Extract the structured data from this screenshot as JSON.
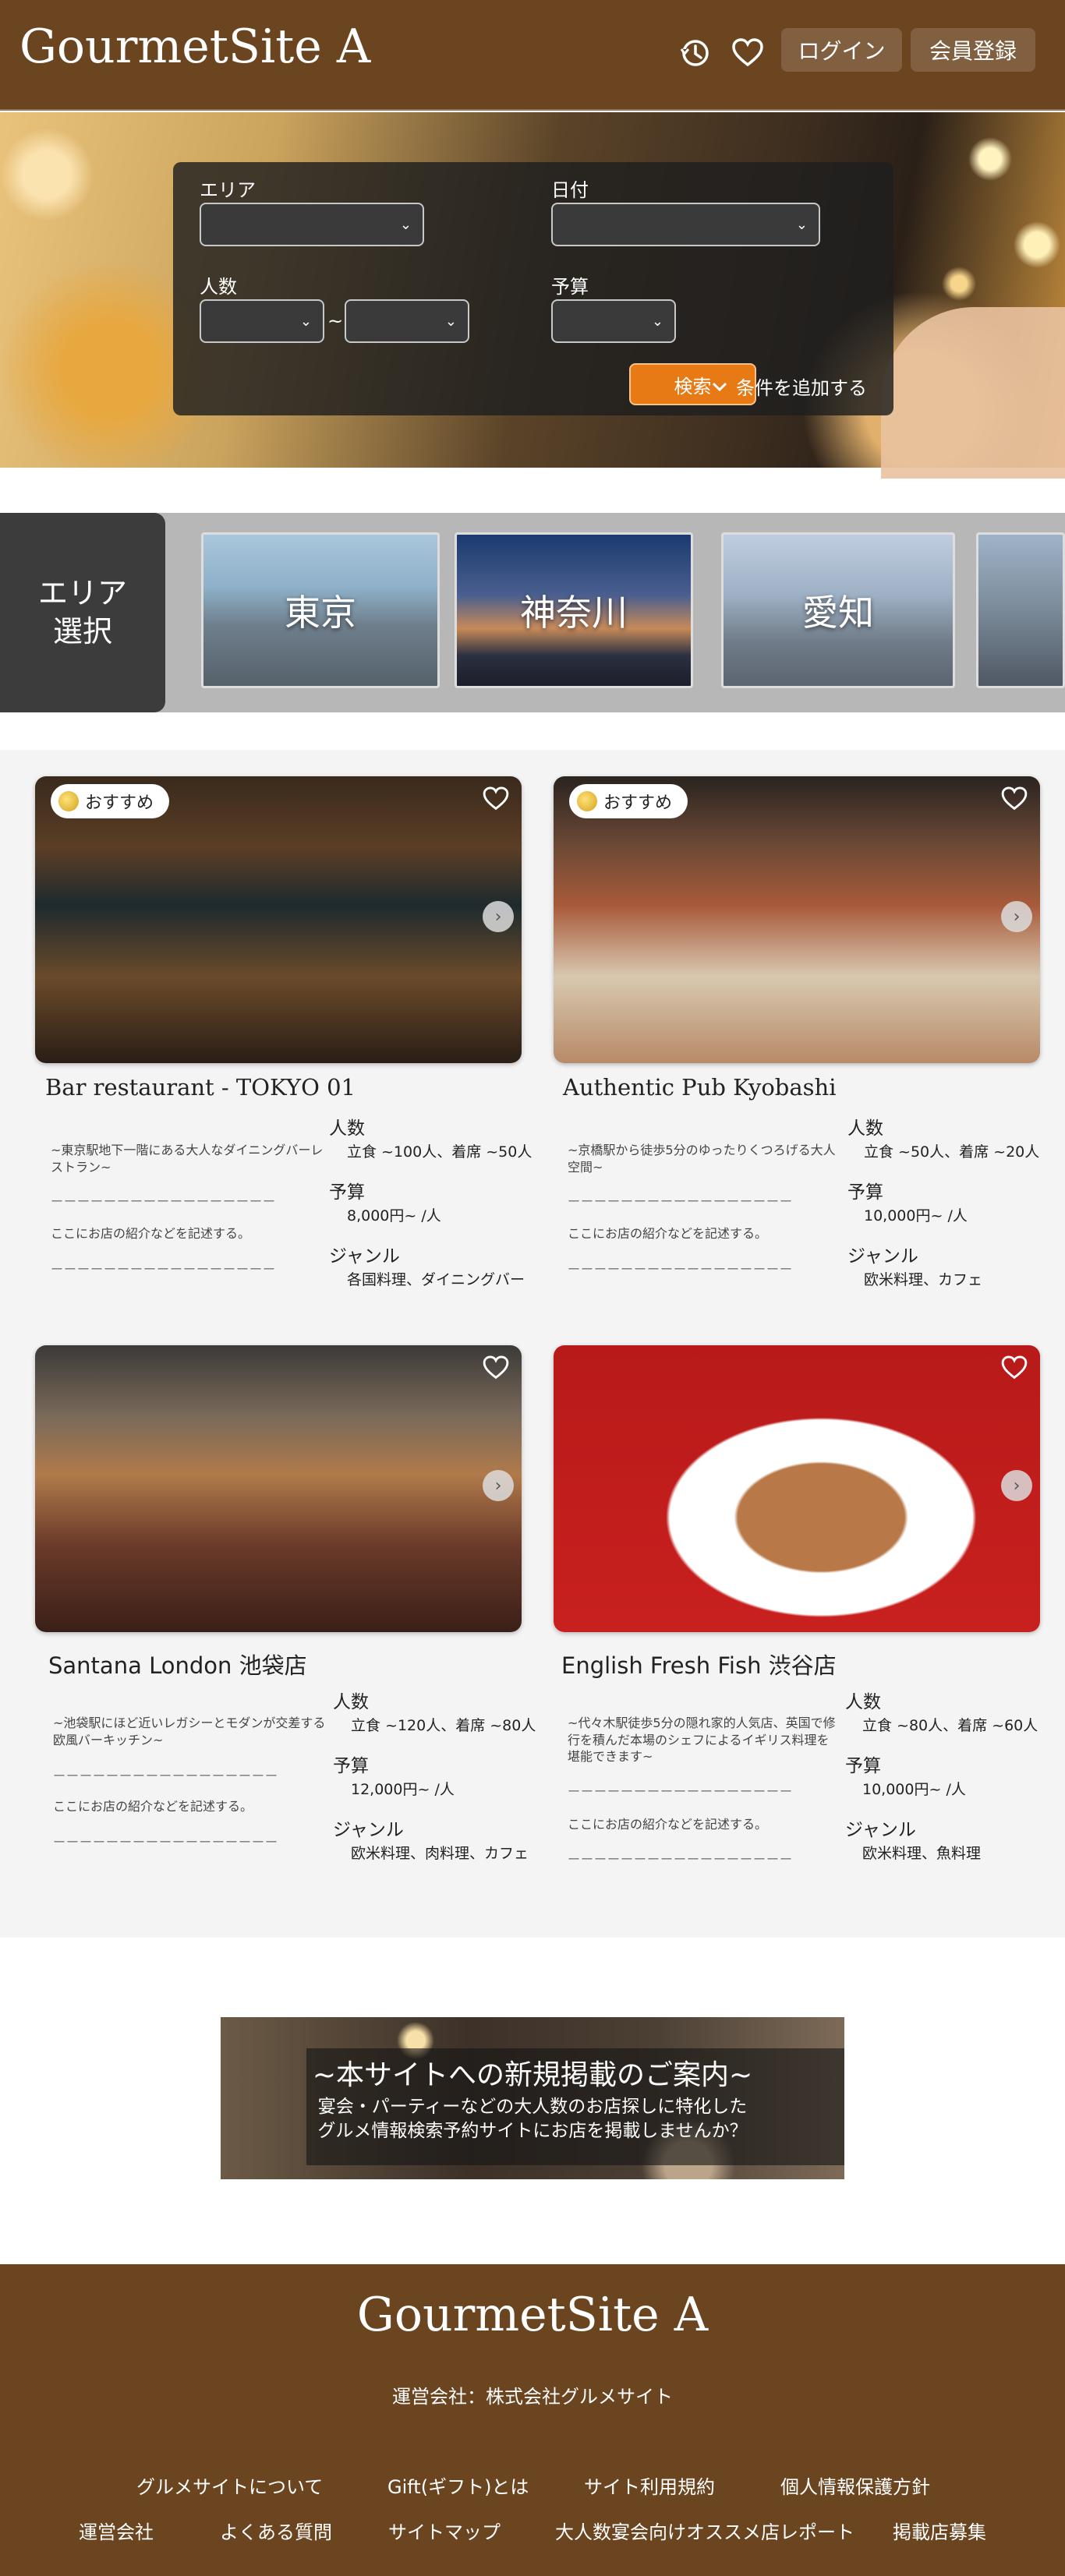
{
  "header": {
    "logo": "GourmetSite A",
    "history_icon": "history-icon",
    "favorite_icon": "heart-icon",
    "login_label": "ログイン",
    "register_label": "会員登録"
  },
  "search": {
    "area_label": "エリア",
    "date_label": "日付",
    "people_label": "人数",
    "budget_label": "予算",
    "range_sep": "~",
    "search_button": "検索",
    "add_conditions": "条件を追加する"
  },
  "area_section": {
    "title_line1": "エリア",
    "title_line2": "選択",
    "areas": [
      {
        "name": "東京"
      },
      {
        "name": "神奈川"
      },
      {
        "name": "愛知"
      },
      {
        "name": ""
      }
    ]
  },
  "restaurants": [
    {
      "badge": "おすすめ",
      "name": "Bar restaurant - TOKYO 01",
      "desc": "~東京駅地下一階にある大人なダイニングバーレストラン~",
      "dash": "ーーーーーーーーーーーーーーーーー",
      "intro": "ここにお店の紹介などを記述する。",
      "people_label": "人数",
      "people": "立食 ~100人、着席 ~50人",
      "budget_label": "予算",
      "budget": "8,000円~ /人",
      "genre_label": "ジャンル",
      "genre": "各国料理、ダイニングバー"
    },
    {
      "badge": "おすすめ",
      "name": "Authentic Pub Kyobashi",
      "desc": "~京橋駅から徒歩5分のゆったりくつろげる大人空間~",
      "dash": "ーーーーーーーーーーーーーーーーー",
      "intro": "ここにお店の紹介などを記述する。",
      "people_label": "人数",
      "people": "立食 ~50人、着席 ~20人",
      "budget_label": "予算",
      "budget": "10,000円~ /人",
      "genre_label": "ジャンル",
      "genre": "欧米料理、カフェ"
    },
    {
      "badge": "",
      "name": "Santana London 池袋店",
      "desc": "~池袋駅にほど近いレガシーとモダンが交差する欧風バーキッチン~",
      "dash": "ーーーーーーーーーーーーーーーーー",
      "intro": "ここにお店の紹介などを記述する。",
      "people_label": "人数",
      "people": "立食 ~120人、着席 ~80人",
      "budget_label": "予算",
      "budget": "12,000円~ /人",
      "genre_label": "ジャンル",
      "genre": "欧米料理、肉料理、カフェ"
    },
    {
      "badge": "",
      "name": "English Fresh Fish 渋谷店",
      "desc": "~代々木駅徒歩5分の隠れ家的人気店、英国で修行を積んだ本場のシェフによるイギリス料理を堪能できます~",
      "dash": "ーーーーーーーーーーーーーーーーー",
      "intro": "ここにお店の紹介などを記述する。",
      "people_label": "人数",
      "people": "立食 ~80人、着席 ~60人",
      "budget_label": "予算",
      "budget": "10,000円~ /人",
      "genre_label": "ジャンル",
      "genre": "欧米料理、魚料理"
    }
  ],
  "banner": {
    "title": "~本サイトへの新規掲載のご案内~",
    "sub_line1": "宴会・パーティーなどの大人数のお店探しに特化した",
    "sub_line2": "グルメ情報検索予約サイトにお店を掲載しませんか？"
  },
  "footer": {
    "logo": "GourmetSite A",
    "company": "運営会社：株式会社グルメサイト",
    "links_row1": [
      "グルメサイトについて",
      "Gift(ギフト)とは",
      "サイト利用規約",
      "個人情報保護方針"
    ],
    "links_row2": [
      "運営会社",
      "よくある質問",
      "サイトマップ",
      "大人数宴会向けオススメ店レポート",
      "掲載店募集"
    ]
  },
  "colors": {
    "brand_brown": "#6b4420",
    "accent_orange": "#e87a16"
  }
}
